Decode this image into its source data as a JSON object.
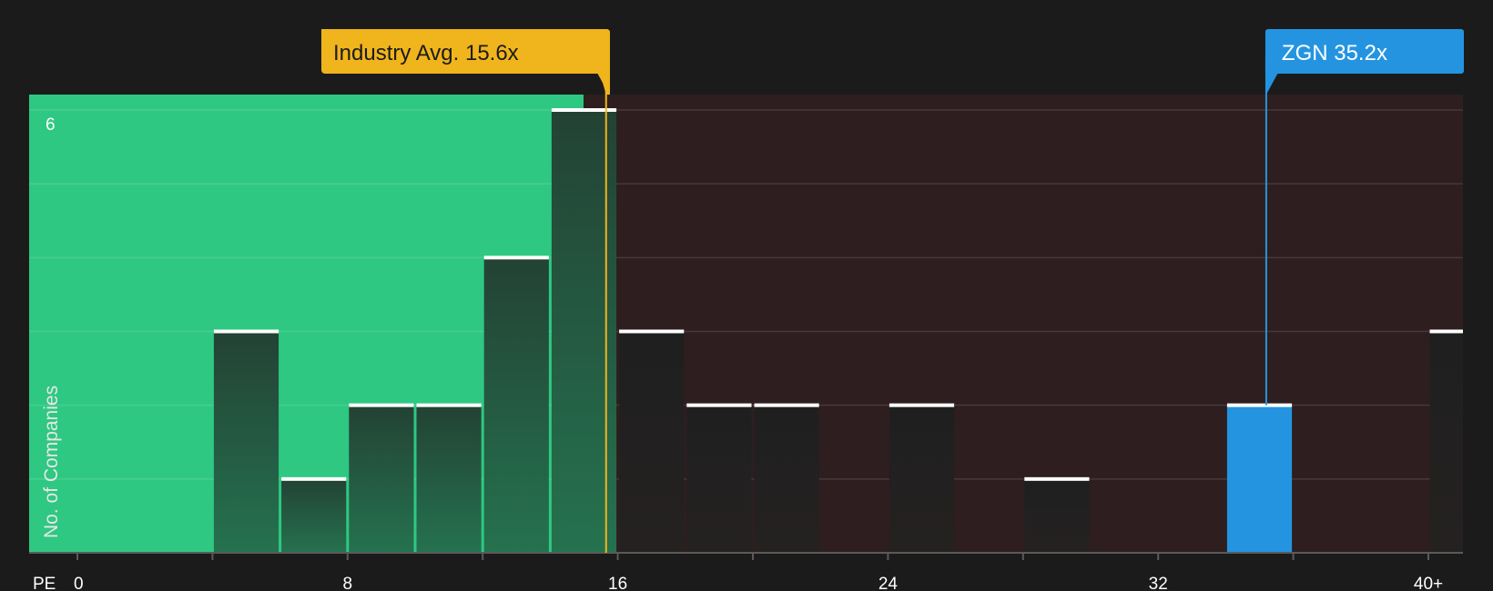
{
  "chart_data": {
    "type": "bar",
    "x_label": "PE",
    "y_label": "No. of Companies",
    "x_ticks": [
      "0",
      "8",
      "16",
      "24",
      "32",
      "40+"
    ],
    "x_tick_values": [
      0,
      8,
      16,
      24,
      32,
      40
    ],
    "y_tick_labels": [
      "6"
    ],
    "xlim": [
      0,
      41.3
    ],
    "ylim": [
      0,
      6.2
    ],
    "bin_width": 2,
    "bins": [
      {
        "x0": 4,
        "x1": 6,
        "count": 3
      },
      {
        "x0": 6,
        "x1": 8,
        "count": 1
      },
      {
        "x0": 8,
        "x1": 10,
        "count": 2
      },
      {
        "x0": 10,
        "x1": 12,
        "count": 2
      },
      {
        "x0": 12,
        "x1": 14,
        "count": 4
      },
      {
        "x0": 14,
        "x1": 16,
        "count": 6
      },
      {
        "x0": 16,
        "x1": 18,
        "count": 3
      },
      {
        "x0": 18,
        "x1": 20,
        "count": 2
      },
      {
        "x0": 20,
        "x1": 22,
        "count": 2
      },
      {
        "x0": 24,
        "x1": 26,
        "count": 2
      },
      {
        "x0": 28,
        "x1": 30,
        "count": 1
      },
      {
        "x0": 34,
        "x1": 36,
        "count": 2,
        "highlight": true
      },
      {
        "x0": 40,
        "x1": 42,
        "count": 3
      }
    ],
    "industry_avg": {
      "label": "Industry Avg. 15.6x",
      "value": 15.6
    },
    "company": {
      "label": "ZGN 35.2x",
      "value": 35.2
    },
    "colors": {
      "background": "#1b1b1b",
      "below_avg_region": "#2ec882",
      "above_avg_region": "#2e1e1f",
      "industry_avg": "#f0b41c",
      "company": "#2494e0",
      "bar_top": "#ffffff"
    }
  }
}
